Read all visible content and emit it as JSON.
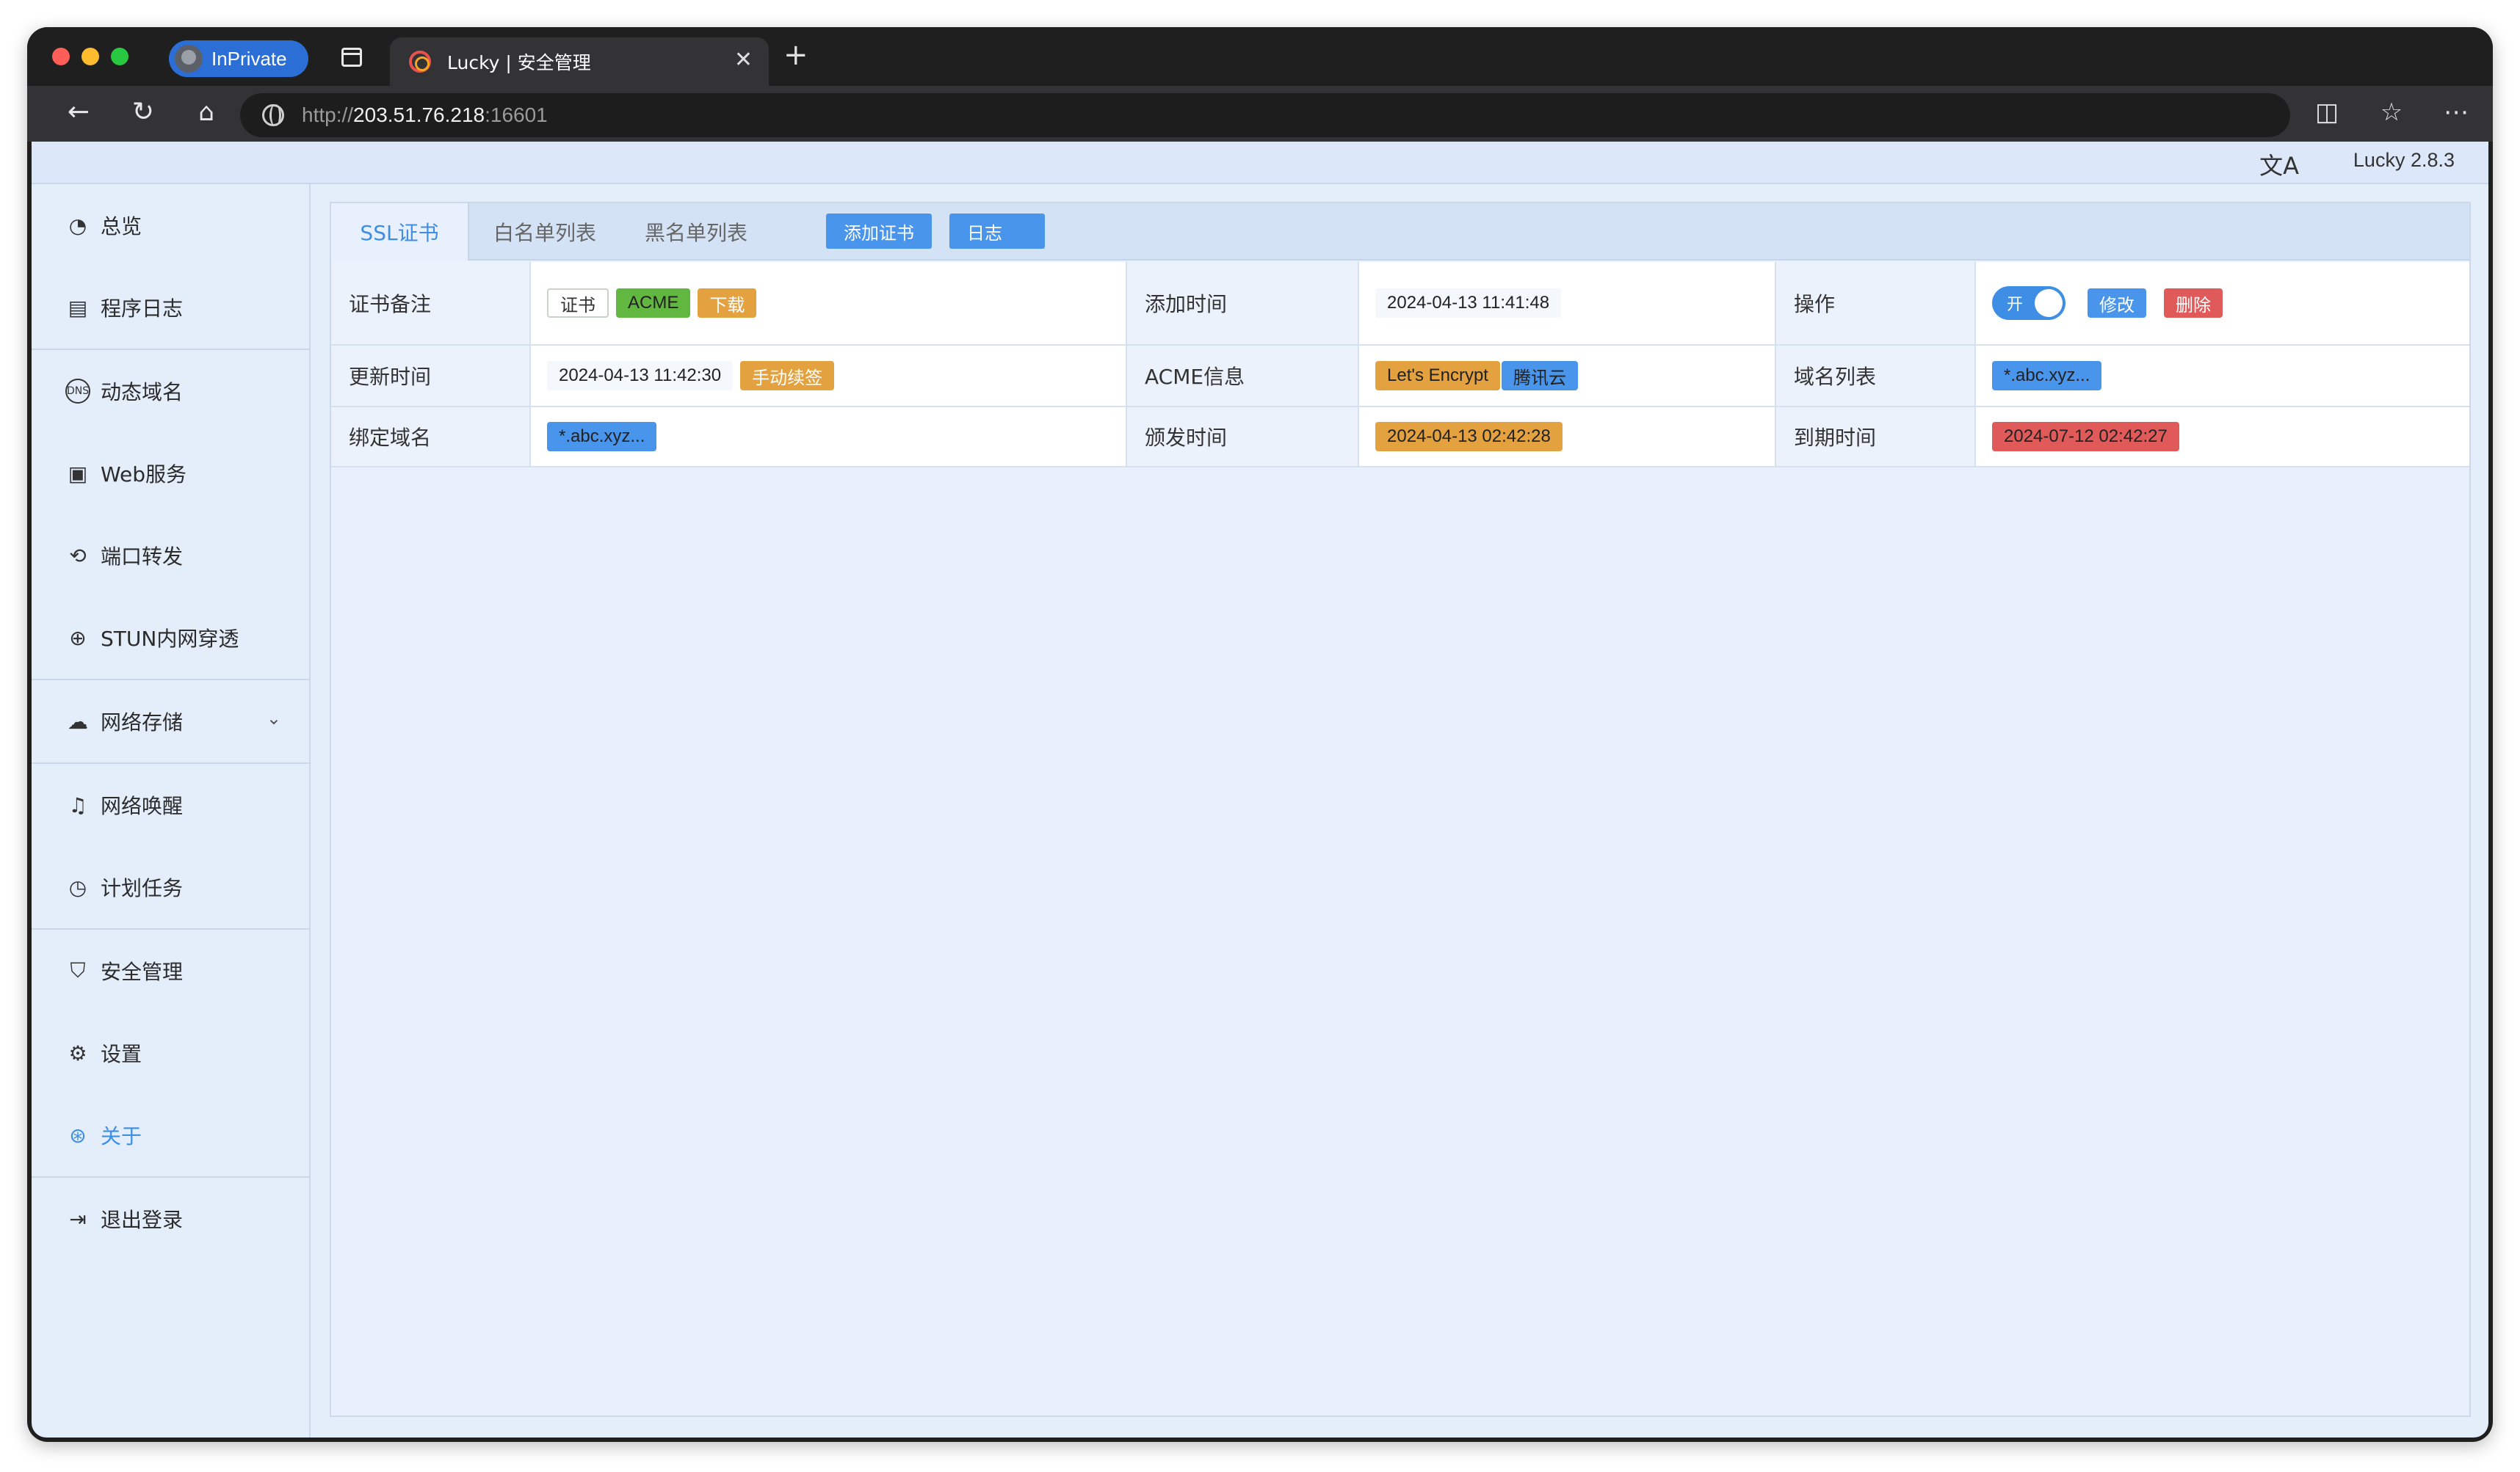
{
  "browser": {
    "inprivate_label": "InPrivate",
    "tab_title": "Lucky | 安全管理",
    "url_scheme": "http://",
    "url_host": "203.51.76.218",
    "url_port": ":16601",
    "traffic_colors": [
      "#ff5f57",
      "#febc2e",
      "#28c840"
    ]
  },
  "header": {
    "translate_icon": "文A",
    "version": "Lucky 2.8.3"
  },
  "sidebar": {
    "items": [
      {
        "label": "总览",
        "icon": "dashboard-icon"
      },
      {
        "label": "程序日志",
        "icon": "log-icon"
      },
      {
        "label": "动态域名",
        "icon": "dns-icon"
      },
      {
        "label": "Web服务",
        "icon": "web-icon"
      },
      {
        "label": "端口转发",
        "icon": "forward-icon"
      },
      {
        "label": "STUN内网穿透",
        "icon": "stun-icon"
      },
      {
        "label": "网络存储",
        "icon": "cloud-icon"
      },
      {
        "label": "网络唤醒",
        "icon": "bell-icon"
      },
      {
        "label": "计划任务",
        "icon": "clock-icon"
      },
      {
        "label": "安全管理",
        "icon": "shield-icon"
      },
      {
        "label": "设置",
        "icon": "gear-icon"
      },
      {
        "label": "关于",
        "icon": "about-icon"
      },
      {
        "label": "退出登录",
        "icon": "logout-icon"
      }
    ]
  },
  "tabs": {
    "ssl": "SSL证书",
    "whitelist": "白名单列表",
    "blacklist": "黑名单列表",
    "add_cert": "添加证书",
    "log": "日志"
  },
  "cert": {
    "labels": {
      "remark": "证书备注",
      "add_time": "添加时间",
      "operation": "操作",
      "update_time": "更新时间",
      "acme_info": "ACME信息",
      "domain_list": "域名列表",
      "bound_domain": "绑定域名",
      "issue_time": "颁发时间",
      "expire_time": "到期时间"
    },
    "remark_tag": "证书",
    "acme_tag": "ACME",
    "download": "下载",
    "add_time": "2024-04-13 11:41:48",
    "toggle_label": "开",
    "toggle_on": true,
    "edit": "修改",
    "delete": "删除",
    "update_time": "2024-04-13 11:42:30",
    "manual_renew": "手动续签",
    "acme_provider": "Let's Encrypt",
    "dns_provider": "腾讯云",
    "domain_list": "*.abc.xyz...",
    "bound_domain": "*.abc.xyz...",
    "issue_time": "2024-04-13 02:42:28",
    "expire_time": "2024-07-12 02:42:27"
  }
}
